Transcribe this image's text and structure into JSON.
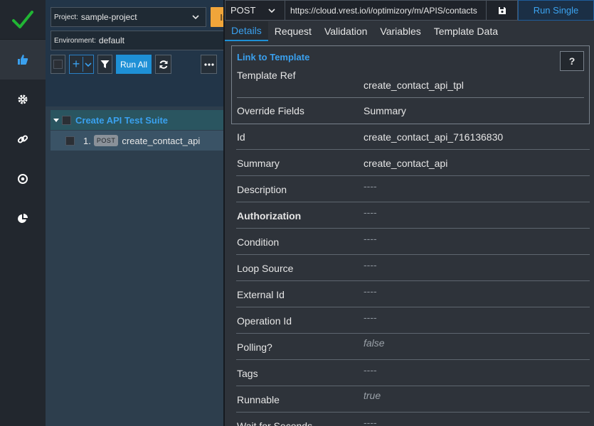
{
  "sidebar": {
    "icons": [
      "check-logo-icon",
      "thumbs-up-icon",
      "gear-icon",
      "link-icon",
      "target-icon",
      "pie-chart-icon"
    ],
    "colors": {
      "check": "#21b534",
      "active_icon": "#3aa0ee"
    }
  },
  "project": {
    "label": "Project:",
    "value": "sample-project"
  },
  "importer_label": "Importer",
  "environment": {
    "label": "Environment:",
    "value": "default"
  },
  "toolbar": {
    "run_all_label": "Run All"
  },
  "tree": {
    "suite_name": "Create API Test Suite",
    "items": [
      {
        "num": "1.",
        "method": "POST",
        "name": "create_contact_api"
      }
    ]
  },
  "request": {
    "method": "POST",
    "url": "https://cloud.vrest.io/i/optimizory/m/APIS/contacts",
    "run_single_label": "Run Single"
  },
  "tabs": [
    "Details",
    "Request",
    "Validation",
    "Variables",
    "Template Data"
  ],
  "template": {
    "title": "Link to Template",
    "help": "?",
    "ref_label": "Template Ref",
    "ref_value": "create_contact_api_tpl",
    "override_label": "Override Fields",
    "override_value": "Summary"
  },
  "fields": [
    {
      "label": "Id",
      "value": "create_contact_api_716136830"
    },
    {
      "label": "Summary",
      "value": "create_contact_api"
    },
    {
      "label": "Description",
      "value": "----"
    },
    {
      "label": "Authorization",
      "value": "----"
    },
    {
      "label": "Condition",
      "value": "----"
    },
    {
      "label": "Loop Source",
      "value": "----"
    },
    {
      "label": "External Id",
      "value": "----"
    },
    {
      "label": "Operation Id",
      "value": "----"
    },
    {
      "label": "Polling?",
      "value": "false"
    },
    {
      "label": "Tags",
      "value": "----"
    },
    {
      "label": "Runnable",
      "value": "true"
    },
    {
      "label": "Wait for Seconds",
      "value": "----"
    }
  ]
}
